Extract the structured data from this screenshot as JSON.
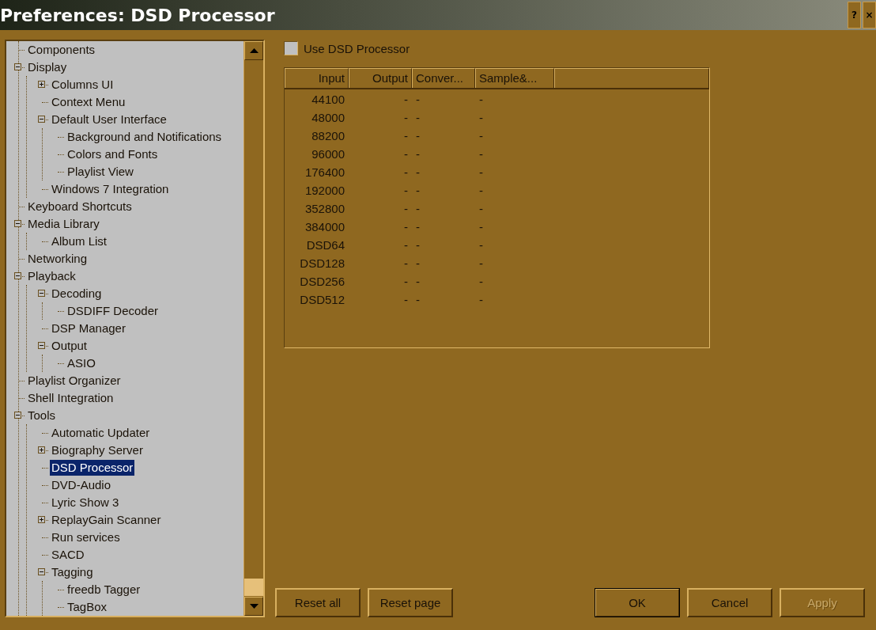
{
  "window": {
    "title": "Preferences: DSD Processor",
    "title_buttons": [
      "?",
      "×"
    ]
  },
  "tree": [
    {
      "label": "Components",
      "selected": false
    },
    {
      "label": "Display",
      "expanded": true,
      "selected": false,
      "children": [
        {
          "label": "Columns UI",
          "expanded": false,
          "selected": false
        },
        {
          "label": "Context Menu",
          "selected": false
        },
        {
          "label": "Default User Interface",
          "expanded": true,
          "selected": false,
          "children": [
            {
              "label": "Background and Notifications",
              "selected": false
            },
            {
              "label": "Colors and Fonts",
              "selected": false
            },
            {
              "label": "Playlist View",
              "selected": false
            }
          ]
        },
        {
          "label": "Windows 7 Integration",
          "selected": false
        }
      ]
    },
    {
      "label": "Keyboard Shortcuts",
      "selected": false
    },
    {
      "label": "Media Library",
      "expanded": true,
      "selected": false,
      "children": [
        {
          "label": "Album List",
          "selected": false
        }
      ]
    },
    {
      "label": "Networking",
      "selected": false
    },
    {
      "label": "Playback",
      "expanded": true,
      "selected": false,
      "children": [
        {
          "label": "Decoding",
          "expanded": true,
          "selected": false,
          "children": [
            {
              "label": "DSDIFF Decoder",
              "selected": false
            }
          ]
        },
        {
          "label": "DSP Manager",
          "selected": false
        },
        {
          "label": "Output",
          "expanded": true,
          "selected": false,
          "children": [
            {
              "label": "ASIO",
              "selected": false
            }
          ]
        }
      ]
    },
    {
      "label": "Playlist Organizer",
      "selected": false
    },
    {
      "label": "Shell Integration",
      "selected": false
    },
    {
      "label": "Tools",
      "expanded": true,
      "selected": false,
      "children": [
        {
          "label": "Automatic Updater",
          "selected": false
        },
        {
          "label": "Biography Server",
          "expanded": false,
          "selected": false
        },
        {
          "label": "DSD Processor",
          "selected": true
        },
        {
          "label": "DVD-Audio",
          "selected": false
        },
        {
          "label": "Lyric Show 3",
          "selected": false
        },
        {
          "label": "ReplayGain Scanner",
          "expanded": false,
          "selected": false
        },
        {
          "label": "Run services",
          "selected": false
        },
        {
          "label": "SACD",
          "selected": false
        },
        {
          "label": "Tagging",
          "expanded": true,
          "selected": false,
          "children": [
            {
              "label": "freedb Tagger",
              "selected": false
            },
            {
              "label": "TagBox",
              "selected": false
            }
          ]
        }
      ]
    }
  ],
  "use_dsd_processor": {
    "label": "Use DSD Processor",
    "checked": false
  },
  "table": {
    "columns": [
      "Input",
      "Output",
      "Conver...",
      "Sample&..."
    ],
    "rows": [
      [
        "44100",
        "-",
        "-",
        "-"
      ],
      [
        "48000",
        "-",
        "-",
        "-"
      ],
      [
        "88200",
        "-",
        "-",
        "-"
      ],
      [
        "96000",
        "-",
        "-",
        "-"
      ],
      [
        "176400",
        "-",
        "-",
        "-"
      ],
      [
        "192000",
        "-",
        "-",
        "-"
      ],
      [
        "352800",
        "-",
        "-",
        "-"
      ],
      [
        "384000",
        "-",
        "-",
        "-"
      ],
      [
        "DSD64",
        "-",
        "-",
        "-"
      ],
      [
        "DSD128",
        "-",
        "-",
        "-"
      ],
      [
        "DSD256",
        "-",
        "-",
        "-"
      ],
      [
        "DSD512",
        "-",
        "-",
        "-"
      ]
    ]
  },
  "buttons": [
    {
      "label": "Reset all",
      "kind": "normal",
      "disabled": false
    },
    {
      "label": "Reset page",
      "kind": "normal",
      "disabled": false
    },
    {
      "label": "OK",
      "kind": "default",
      "disabled": false
    },
    {
      "label": "Cancel",
      "kind": "normal",
      "disabled": false
    },
    {
      "label": "Apply",
      "kind": "normal",
      "disabled": true
    }
  ]
}
